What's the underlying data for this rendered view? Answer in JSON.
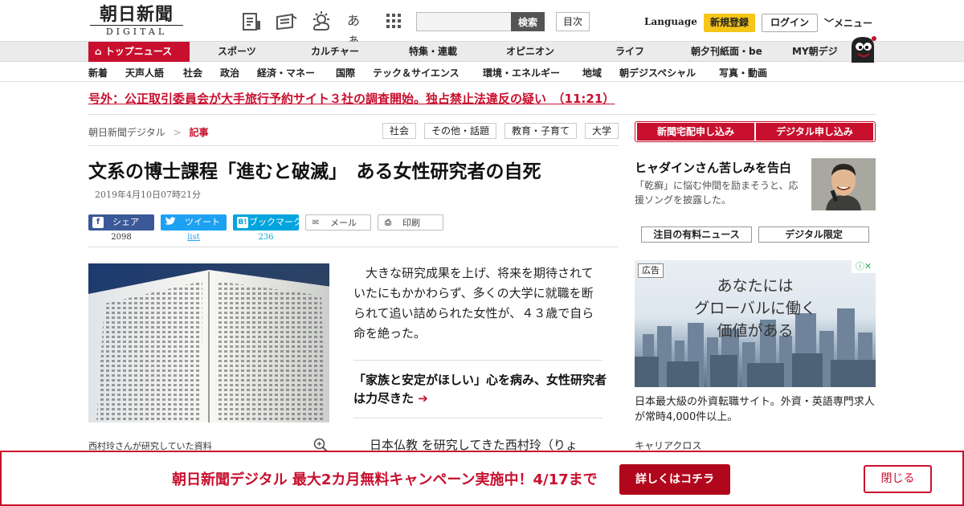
{
  "header": {
    "logo_jp": "朝日新聞",
    "logo_en": "DIGITAL",
    "icons": [
      "news-list-icon",
      "paper-edition-icon",
      "weather-icon",
      "font-size-icon",
      "app-grid-icon"
    ],
    "font_size_glyph": "あぁ",
    "search_placeholder": "",
    "search_button": "検索",
    "toc_button": "目次",
    "language": "Language",
    "register": "新規登録",
    "login": "ログイン",
    "menu": "メニュー"
  },
  "catnav": {
    "top": "トップニュース",
    "items": [
      "スポーツ",
      "カルチャー",
      "特集・連載",
      "オピニオン",
      "ライフ",
      "朝夕刊紙面・be",
      "MY朝デジ"
    ]
  },
  "subnav": {
    "items": [
      "新着",
      "天声人語",
      "社会",
      "政治",
      "経済・マネー",
      "国際",
      "テック＆サイエンス",
      "環境・エネルギー",
      "地域",
      "朝デジスペシャル",
      "写真・動画"
    ]
  },
  "breaking": "号外：公正取引委員会が大手旅行予約サイト３社の調査開始。独占禁止法違反の疑い　（11:21）",
  "breadcrumb": {
    "home": "朝日新聞デジタル",
    "sep": ">",
    "current": "記事"
  },
  "tags": [
    "社会",
    "その他・話題",
    "教育・子育て",
    "大学"
  ],
  "article": {
    "title": "文系の博士課程「進むと破滅」　ある女性研究者の自死",
    "date": "2019年4月10日07時21分",
    "caption": "西村玲さんが研究していた資料",
    "lead": "　大きな研究成果を上げ、将来を期待されていたにもかかわらず、多くの大学に就職を断られて追い詰められた女性が、４３歳で自ら命を絶った。",
    "related": "「家族と安定がほしい」心を病み、女性研究者は力尽きた",
    "related_arrow": "➔",
    "body_start": "日本仏教 を研究してきた西村玲（りょ"
  },
  "share": {
    "facebook": {
      "label": "シェア",
      "count": "2098",
      "icon": "f"
    },
    "twitter": {
      "label": "ツイート",
      "count": "list",
      "icon": "t"
    },
    "hatena": {
      "label": "ブックマーク",
      "count": "236",
      "icon": "B!"
    },
    "mail": {
      "label": "メール"
    },
    "print": {
      "label": "印刷"
    }
  },
  "sidebar": {
    "subscribe_paper": "新聞宅配申し込み",
    "subscribe_digital": "デジタル申し込み",
    "feature_title": "ヒャダインさん苦しみを告白",
    "feature_desc": "「乾癬」に悩む仲間を励まそうと、応援ソングを披露した。",
    "tabs": [
      "注目の有料ニュース",
      "デジタル限定"
    ],
    "ad_label": "広告",
    "ad_close": "ⓘ✕",
    "ad_copy": [
      "あなたには",
      "グローバルに働く",
      "価値がある"
    ],
    "ad_text": "日本最大級の外資転職サイト。外資・英語専門求人が常時4,000件以上。",
    "ad_source": "キャリアクロス"
  },
  "campaign": {
    "text": "朝日新聞デジタル 最大2カ月無料キャンペーン実施中！4/17まで",
    "cta": "詳しくはコチラ",
    "close": "閉じる"
  },
  "colors": {
    "brand_red": "#c8102e",
    "register_yellow": "#f5c518",
    "twitter_blue": "#1da1f2",
    "facebook_blue": "#3b5998",
    "hatena_blue": "#00a4de"
  }
}
